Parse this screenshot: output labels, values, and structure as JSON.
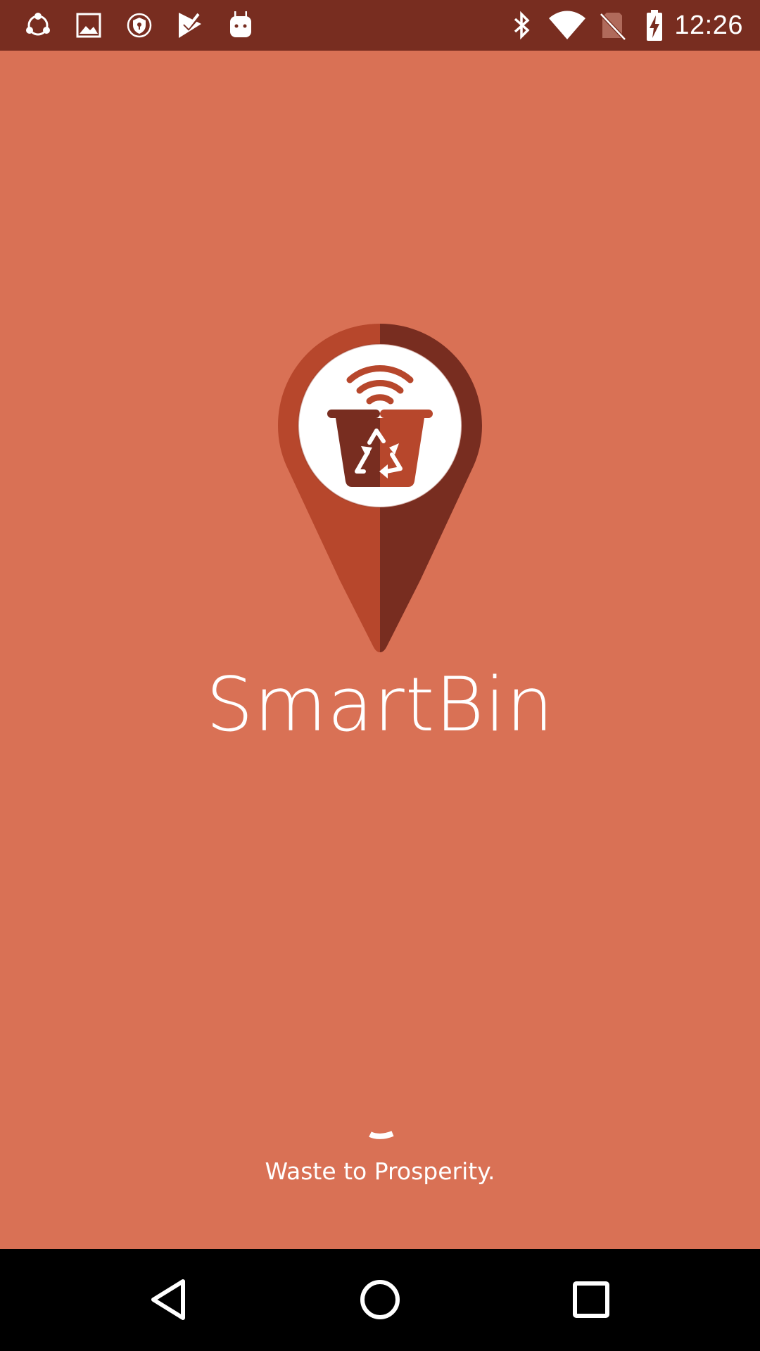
{
  "status_bar": {
    "time": "12:26",
    "left_icons": [
      "share-hub-icon",
      "gallery-icon",
      "security-shield-icon",
      "task-check-icon",
      "android-robot-icon"
    ],
    "right_icons": [
      "bluetooth-icon",
      "wifi-icon",
      "no-sim-icon",
      "battery-charging-icon"
    ],
    "background_color": "#782d20"
  },
  "splash": {
    "app_name": "SmartBin",
    "tagline": "Waste to Prosperity.",
    "logo_icon": "smart-bin-location-pin-icon",
    "background_color": "#d97155",
    "logo_colors": {
      "pin_left": "#b7472c",
      "pin_right": "#782d20",
      "inner_circle": "#ffffff"
    },
    "loading": true
  },
  "nav_bar": {
    "buttons": [
      "back-icon",
      "home-icon",
      "recents-icon"
    ]
  }
}
